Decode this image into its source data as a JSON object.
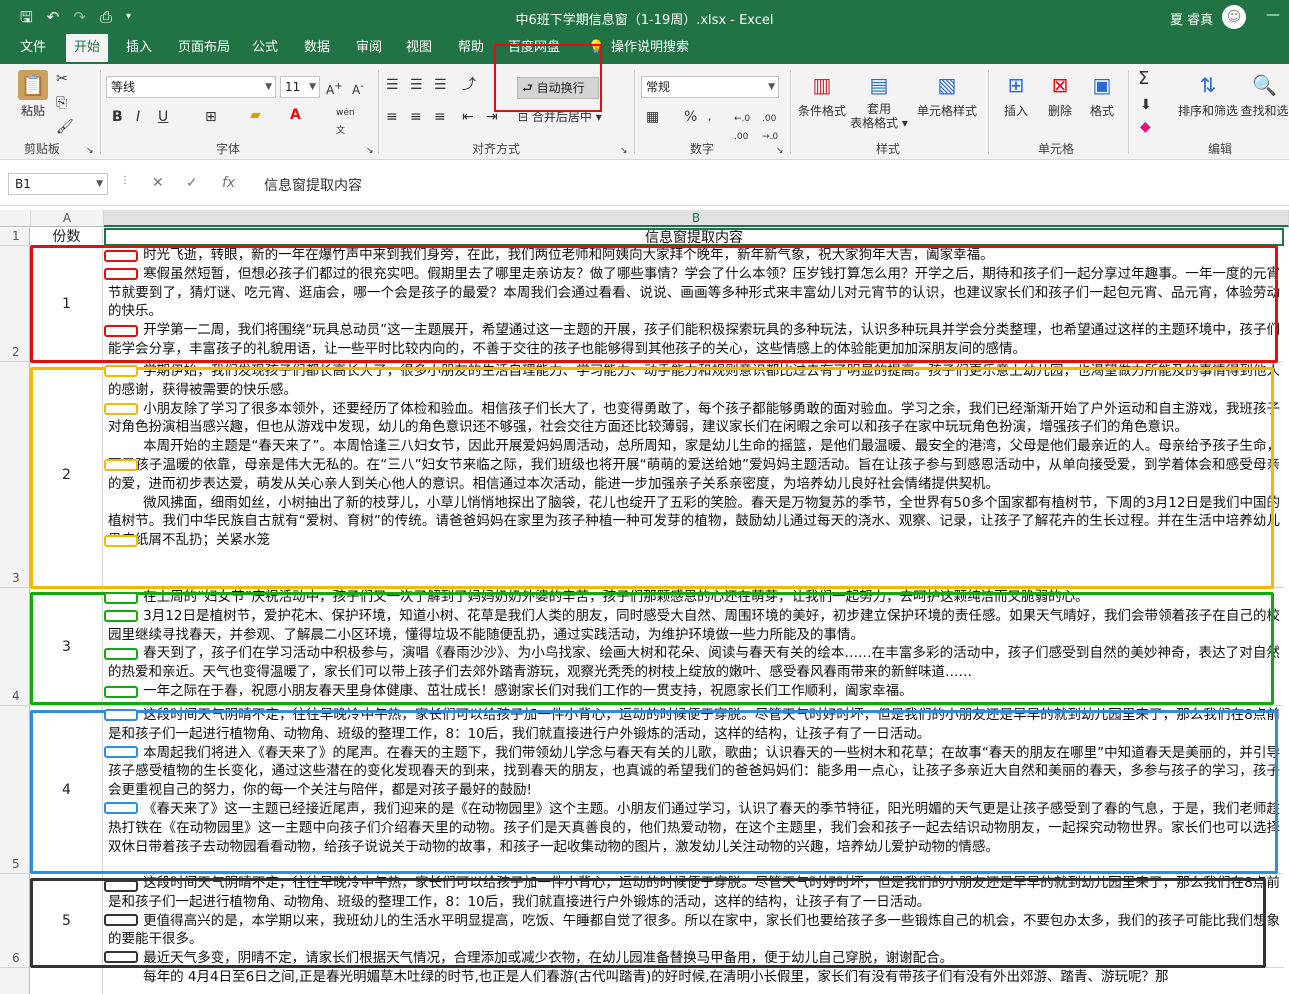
{
  "titlebar": {
    "title": "中6班下学期信息窗（1-19周）.xlsx  -  Excel",
    "user": "夏 睿真"
  },
  "tabs": [
    "文件",
    "开始",
    "插入",
    "页面布局",
    "公式",
    "数据",
    "审阅",
    "视图",
    "帮助",
    "百度网盘",
    "操作说明搜索"
  ],
  "ribbon": {
    "paste": "粘贴",
    "font_name": "等线",
    "font_size": "11",
    "wen": "wén",
    "wrap_text": "自动换行",
    "merge_center": "合并后居中",
    "number_format": "常规",
    "cond_format": "条件格式",
    "table_format_1": "套用",
    "table_format_2": "表格格式",
    "cell_style": "单元格样式",
    "insert": "插入",
    "delete": "删除",
    "format": "格式",
    "sort_filter": "排序和筛选",
    "find_select": "查找和选",
    "groups": {
      "clipboard": "剪贴板",
      "font": "字体",
      "alignment": "对齐方式",
      "number": "数字",
      "styles": "样式",
      "cells": "单元格",
      "editing": "编辑"
    }
  },
  "formula_bar": {
    "name_box": "B1",
    "formula": "信息窗提取内容"
  },
  "columns": [
    "A",
    "B"
  ],
  "rows": [
    "1",
    "2",
    "3",
    "4",
    "5",
    "6"
  ],
  "header_row": {
    "a": "份数",
    "b": "信息窗提取内容"
  },
  "cells": [
    {
      "a": "1",
      "paras": [
        "时光飞逝，转眼，新的一年在爆竹声中来到我们身旁，在此，我们两位老师和阿姨向大家拜个晚年，新年新气象，祝大家狗年大吉，阖家幸福。",
        "寒假虽然短暂，但想必孩子们都过的很充实吧。假期里去了哪里走亲访友？做了哪些事情？学会了什么本领？压岁钱打算怎么用？开学之后，期待和孩子们一起分享过年趣事。一年一度的元宵节就要到了，猜灯谜、吃元宵、逛庙会，哪一个会是孩子的最爱？本周我们会通过看看、说说、画画等多种形式来丰富幼儿对元宵节的认识，也建议家长们和孩子们一起包元宵、品元宵，体验劳动的快乐。",
        "开学第一二周，我们将围绕“玩具总动员”这一主题展开，希望通过这一主题的开展，孩子们能积极探索玩具的多种玩法，认识多种玩具并学会分类整理，也希望通过这样的主题环境中，孩子们能学会分享，丰富孩子的礼貌用语，让一些平时比较内向的，不善于交往的孩子也能够得到其他孩子的关心，这些情感上的体验能更加加深朋友间的感情。"
      ]
    },
    {
      "a": "2",
      "paras": [
        "学期伊始，我们发现孩子们都长高长大了，很多小朋友的生活自理能力、学习能力、动手能力和规则意识都比过去有了明显的提高。孩子们更乐意上幼儿园，也渴望做力所能及的事情得到他人的感谢，获得被需要的快乐感。",
        "小朋友除了学习了很多本领外，还要经历了体检和验血。相信孩子们长大了，也变得勇敢了，每个孩子都能够勇敢的面对验血。学习之余，我们已经渐渐开始了户外运动和自主游戏，我班孩子对角色扮演相当感兴趣，但也从游戏中发现，幼儿的角色意识还不够强，社会交往方面还比较薄弱，建议家长们在闲暇之余可以和孩子在家中玩玩角色扮演，增强孩子们的角色意识。",
        "本周开始的主题是“春天来了”。本周恰逢三八妇女节，因此开展爱妈妈周活动，总所周知，家是幼儿生命的摇篮，是他们最温暖、最安全的港湾，父母是他们最亲近的人。母亲给予孩子生命，更是孩子温暖的依靠，母亲是伟大无私的。在“三八”妇女节来临之际，我们班级也将开展“萌萌的爱送给她”爱妈妈主题活动。旨在让孩子参与到感恩活动中，从单向接受爱，到学着体会和感受母亲的爱，进而初步表达爱，萌发从关心亲人到关心他人的意识。相信通过本次活动，能进一步加强亲子关系亲密度，为培养幼儿良好社会情绪提供契机。",
        "微风拂面，细雨如丝，小树抽出了新的枝芽儿，小草儿悄悄地探出了脑袋，花儿也绽开了五彩的笑脸。春天是万物复苏的季节，全世界有50多个国家都有植树节，下周的3月12日是我们中国的植树节。我们中华民族自古就有“爱树、育树”的传统。请爸爸妈妈在家里为孩子种植一种可发芽的植物，鼓励幼儿通过每天的浇水、观察、记录，让孩子了解花卉的生长过程。并在生活中培养幼儿果皮纸屑不乱扔；关紧水笼"
      ]
    },
    {
      "a": "3",
      "paras": [
        "在上周的“妇女节”庆祝活动中，孩子们又一次了解到了妈妈奶奶外婆的辛苦，孩子们那颗感恩的心还在萌芽，让我们一起努力，去呵护这颗纯洁而又脆弱的心。",
        "3月12日是植树节，爱护花木、保护环境，知道小树、花草是我们人类的朋友，同时感受大自然、周围环境的美好，初步建立保护环境的责任感。如果天气晴好，我们会带领着孩子在自己的校园里继续寻找春天，并参观、了解晨二小区环境，懂得垃圾不能随便乱扔，通过实践活动，为维护环境做一些力所能及的事情。",
        "春天到了，孩子们在学习活动中积极参与，演唱《春雨沙沙》、为小鸟找家、绘画大树和花朵、阅读与春天有关的绘本……在丰富多彩的活动中，孩子们感受到自然的美妙神奇，表达了对自然的热爱和亲近。天气也变得温暖了，家长们可以带上孩子们去郊外踏青游玩，观察光秃秃的树枝上绽放的嫩叶、感受春风春雨带来的新鲜味道……",
        "一年之际在于春，祝愿小朋友春天里身体健康、茁壮成长！感谢家长们对我们工作的一贯支持，祝愿家长们工作顺利，阖家幸福。"
      ]
    },
    {
      "a": "4",
      "paras": [
        "这段时间天气阴晴不定，往往早晚冷中午热，家长们可以给孩子加一件小背心，运动的时候便于穿脱。尽管天气时好时坏，但是我们的小朋友还是早早的就到幼儿园里来了，那么我们在8点前是和孩子们一起进行植物角、动物角、班级的整理工作，8：10后，我们就直接进行户外锻炼的活动，这样的结构，让孩子有了一日活动。",
        "本周起我们将进入《春天来了》的尾声。在春天的主题下，我们带领幼儿学念与春天有关的儿歌，歌曲；认识春天的一些树木和花草；在故事“春天的朋友在哪里”中知道春天是美丽的，并引导孩子感受植物的生长变化，通过这些潜在的变化发现春天的到来，找到春天的朋友，也真诚的希望我们的爸爸妈妈们：能多用一点心，让孩子多亲近大自然和美丽的春天，多参与孩子的学习，孩子会更重视自己的努力，你的每一个关注与陪伴，都是对孩子最好的鼓励!",
        "《春天来了》这一主题已经接近尾声，我们迎来的是《在动物园里》这个主题。小朋友们通过学习，认识了春天的季节特征，阳光明媚的天气更是让孩子感受到了春的气息，于是，我们老师趁热打铁在《在动物园里》这一主题中向孩子们介绍春天里的动物。孩子们是天真善良的，他们热爱动物，在这个主题里，我们会和孩子一起去结识动物朋友，一起探究动物世界。家长们也可以选择双休日带着孩子去动物园看看动物，给孩子说说关于动物的故事，和孩子一起收集动物的图片，激发幼儿关注动物的兴趣，培养幼儿爱护动物的情感。"
      ]
    },
    {
      "a": "5",
      "paras": [
        "这段时间天气阴晴不定，往往早晚冷中午热，家长们可以给孩子加一件小背心，运动的时候便于穿脱。尽管天气时好时坏，但是我们的小朋友还是早早的就到幼儿园里来了，那么我们在8点前是和孩子们一起进行植物角、动物角、班级的整理工作，8：10后，我们就直接进行户外锻炼的活动，这样的结构，让孩子有了一日活动。",
        "更值得高兴的是，本学期以来，我班幼儿的生活水平明显提高，吃饭、午睡都自觉了很多。所以在家中，家长们也要给孩子多一些锻炼自己的机会，不要包办太多，我们的孩子可能比我们想象的要能干很多。",
        "最近天气多变，阴晴不定，请家长们根据天气情况，合理添加或减少衣物，在幼儿园准备替换马甲备用，便于幼儿自己穿脱，谢谢配合。"
      ]
    },
    {
      "a": "",
      "paras": [
        "每年的 4月4日至6日之间,正是春光明媚草木吐绿的时节,也正是人们春游(古代叫踏青)的好时候,在清明小长假里，家长们有没有带孩子们有没有外出郊游、踏青、游玩呢？那"
      ]
    }
  ],
  "colors": {
    "excel_green": "#217346",
    "red": "#e01010",
    "orange": "#f5b800",
    "green": "#13a813",
    "blue": "#2b8ee0",
    "black": "#333333"
  }
}
